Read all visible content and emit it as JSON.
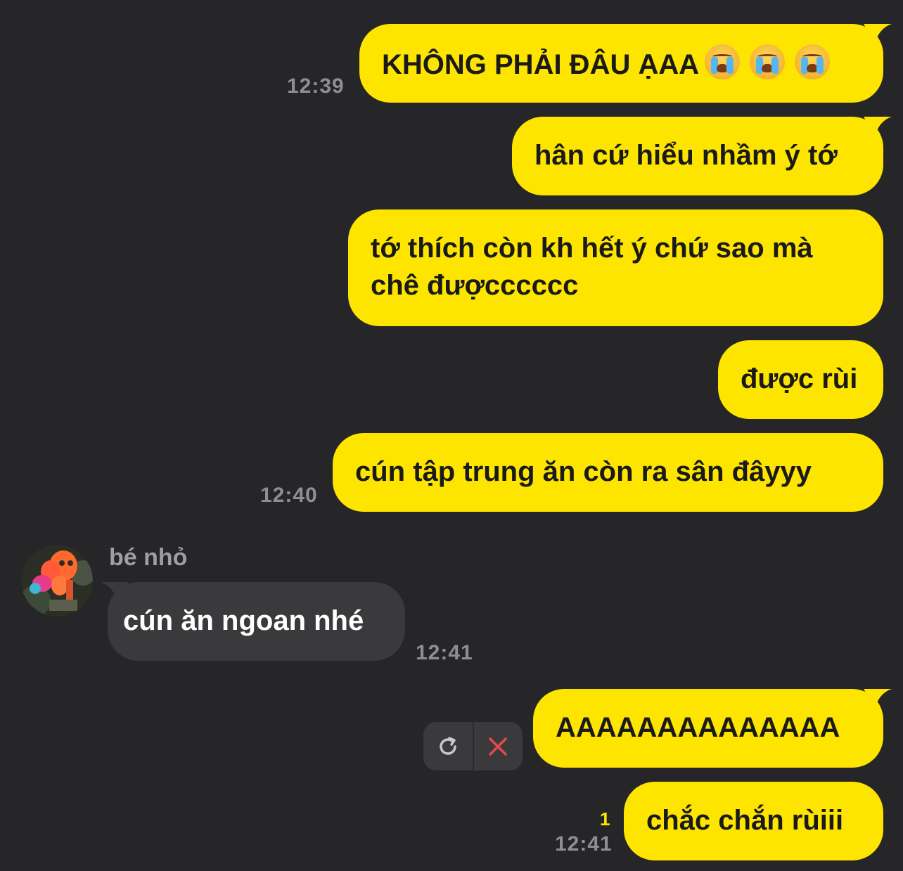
{
  "messages": {
    "m1": {
      "text": "KHÔNG PHẢI ĐÂU ẠAA",
      "emoji": "loudly-crying-face",
      "emoji_count": 3,
      "time": "12:39"
    },
    "m2": {
      "text": "hân cứ hiểu nhầm ý tớ"
    },
    "m3": {
      "line1": "tớ thích còn kh hết ý chứ sao mà",
      "line2": "chê đượcccccc"
    },
    "m4": {
      "text": "được rùi"
    },
    "m5": {
      "text": "cún tập trung ăn còn ra sân đâyyy",
      "time": "12:40"
    },
    "m6": {
      "sender": "bé nhỏ",
      "text": "cún ăn ngoan nhé",
      "time": "12:41"
    },
    "m7": {
      "text": "AAAAAAAAAAAAAA",
      "retry_icon": "refresh-icon",
      "cancel_icon": "close-icon"
    },
    "m8": {
      "text": "chắc chắn rùiii",
      "unread": "1",
      "time": "12:41"
    }
  },
  "colors": {
    "background": "#262628",
    "sent_bubble": "#fee500",
    "received_bubble": "#3a3a3c",
    "timestamp": "#8e8e93",
    "unread_count": "#fee500",
    "cancel_x": "#e5484d"
  }
}
